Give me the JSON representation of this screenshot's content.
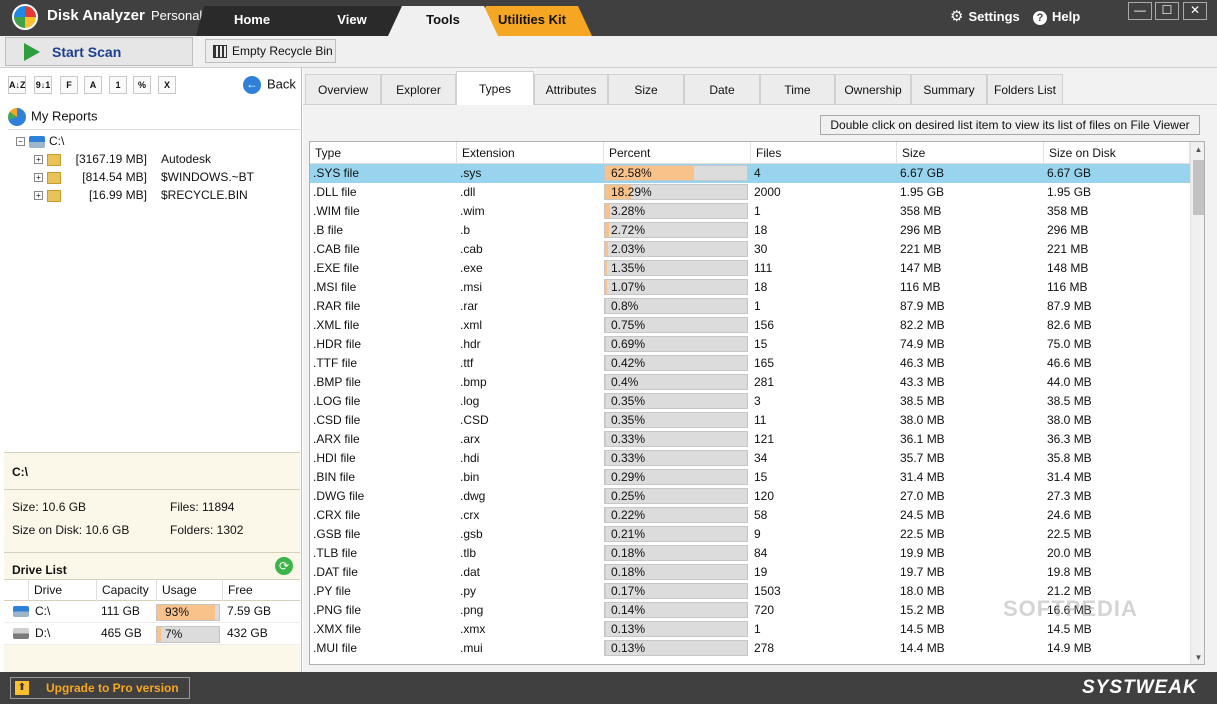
{
  "app": {
    "title": "Disk Analyzer",
    "edition": "Personal"
  },
  "nav_tabs": {
    "home": "Home",
    "view": "View",
    "tools": "Tools",
    "utilities": "Utilities Kit"
  },
  "header_links": {
    "settings": "Settings",
    "help": "Help"
  },
  "window_controls": {
    "minimize": "—",
    "maximize": "☐",
    "close": "✕"
  },
  "toolbar": {
    "start_scan": "Start Scan",
    "empty_bin": "Empty Recycle Bin"
  },
  "left": {
    "sort_buttons": [
      "A↓Z",
      "9↓1",
      "F",
      "A",
      "1",
      "%",
      "X"
    ],
    "back": "Back",
    "my_reports": "My Reports",
    "tree_root": "C:\\",
    "tree_items": [
      {
        "size": "[3167.19 MB]",
        "name": "Autodesk"
      },
      {
        "size": "[814.54 MB]",
        "name": "$WINDOWS.~BT"
      },
      {
        "size": "[16.99 MB]",
        "name": "$RECYCLE.BIN"
      }
    ],
    "info": {
      "title": "C:\\",
      "size": "Size: 10.6 GB",
      "files": "Files: 11894",
      "size_on_disk": "Size on Disk: 10.6 GB",
      "folders": "Folders: 1302"
    },
    "drive_list": {
      "title": "Drive List",
      "headers": [
        "Drive",
        "Capacity",
        "Usage",
        "Free"
      ],
      "rows": [
        {
          "drive": "C:\\",
          "capacity": "111 GB",
          "usage": "93%",
          "usage_frac": 0.93,
          "free": "7.59 GB"
        },
        {
          "drive": "D:\\",
          "capacity": "465 GB",
          "usage": "7%",
          "usage_frac": 0.07,
          "free": "432 GB"
        }
      ]
    }
  },
  "right": {
    "tabs": [
      "Overview",
      "Explorer",
      "Types",
      "Attributes",
      "Size",
      "Date",
      "Time",
      "Ownership",
      "Summary",
      "Folders List"
    ],
    "active_tab": "Types",
    "hint": "Double click on desired list item to view its list of files on File Viewer",
    "columns": [
      "Type",
      "Extension",
      "Percent",
      "Files",
      "Size",
      "Size on Disk"
    ],
    "rows": [
      [
        ".SYS file",
        ".sys",
        "62.58%",
        "4",
        "6.67 GB",
        "6.67 GB"
      ],
      [
        ".DLL file",
        ".dll",
        "18.29%",
        "2000",
        "1.95 GB",
        "1.95 GB"
      ],
      [
        ".WIM file",
        ".wim",
        "3.28%",
        "1",
        "358 MB",
        "358 MB"
      ],
      [
        ".B file",
        ".b",
        "2.72%",
        "18",
        "296 MB",
        "296 MB"
      ],
      [
        ".CAB file",
        ".cab",
        "2.03%",
        "30",
        "221 MB",
        "221 MB"
      ],
      [
        ".EXE file",
        ".exe",
        "1.35%",
        "111",
        "147 MB",
        "148 MB"
      ],
      [
        ".MSI file",
        ".msi",
        "1.07%",
        "18",
        "116 MB",
        "116 MB"
      ],
      [
        ".RAR file",
        ".rar",
        "0.8%",
        "1",
        "87.9 MB",
        "87.9 MB"
      ],
      [
        ".XML file",
        ".xml",
        "0.75%",
        "156",
        "82.2 MB",
        "82.6 MB"
      ],
      [
        ".HDR file",
        ".hdr",
        "0.69%",
        "15",
        "74.9 MB",
        "75.0 MB"
      ],
      [
        ".TTF file",
        ".ttf",
        "0.42%",
        "165",
        "46.3 MB",
        "46.6 MB"
      ],
      [
        ".BMP file",
        ".bmp",
        "0.4%",
        "281",
        "43.3 MB",
        "44.0 MB"
      ],
      [
        ".LOG file",
        ".log",
        "0.35%",
        "3",
        "38.5 MB",
        "38.5 MB"
      ],
      [
        ".CSD file",
        ".CSD",
        "0.35%",
        "11",
        "38.0 MB",
        "38.0 MB"
      ],
      [
        ".ARX file",
        ".arx",
        "0.33%",
        "121",
        "36.1 MB",
        "36.3 MB"
      ],
      [
        ".HDI file",
        ".hdi",
        "0.33%",
        "34",
        "35.7 MB",
        "35.8 MB"
      ],
      [
        ".BIN file",
        ".bin",
        "0.29%",
        "15",
        "31.4 MB",
        "31.4 MB"
      ],
      [
        ".DWG file",
        ".dwg",
        "0.25%",
        "120",
        "27.0 MB",
        "27.3 MB"
      ],
      [
        ".CRX file",
        ".crx",
        "0.22%",
        "58",
        "24.5 MB",
        "24.6 MB"
      ],
      [
        ".GSB file",
        ".gsb",
        "0.21%",
        "9",
        "22.5 MB",
        "22.5 MB"
      ],
      [
        ".TLB file",
        ".tlb",
        "0.18%",
        "84",
        "19.9 MB",
        "20.0 MB"
      ],
      [
        ".DAT file",
        ".dat",
        "0.18%",
        "19",
        "19.7 MB",
        "19.8 MB"
      ],
      [
        ".PY file",
        ".py",
        "0.17%",
        "1503",
        "18.0 MB",
        "21.2 MB"
      ],
      [
        ".PNG file",
        ".png",
        "0.14%",
        "720",
        "15.2 MB",
        "16.6 MB"
      ],
      [
        ".XMX file",
        ".xmx",
        "0.13%",
        "1",
        "14.5 MB",
        "14.5 MB"
      ],
      [
        ".MUI file",
        ".mui",
        "0.13%",
        "278",
        "14.4 MB",
        "14.9 MB"
      ]
    ],
    "watermark": "SOFTPEDIA"
  },
  "footer": {
    "upgrade": "Upgrade to Pro version",
    "brand": "SYSTWEAK"
  },
  "colors": {
    "titlebar": "#404040",
    "accent_tab": "#f5a623",
    "selected_row": "#99d4ee",
    "bar_fill": "#f9c28b"
  }
}
